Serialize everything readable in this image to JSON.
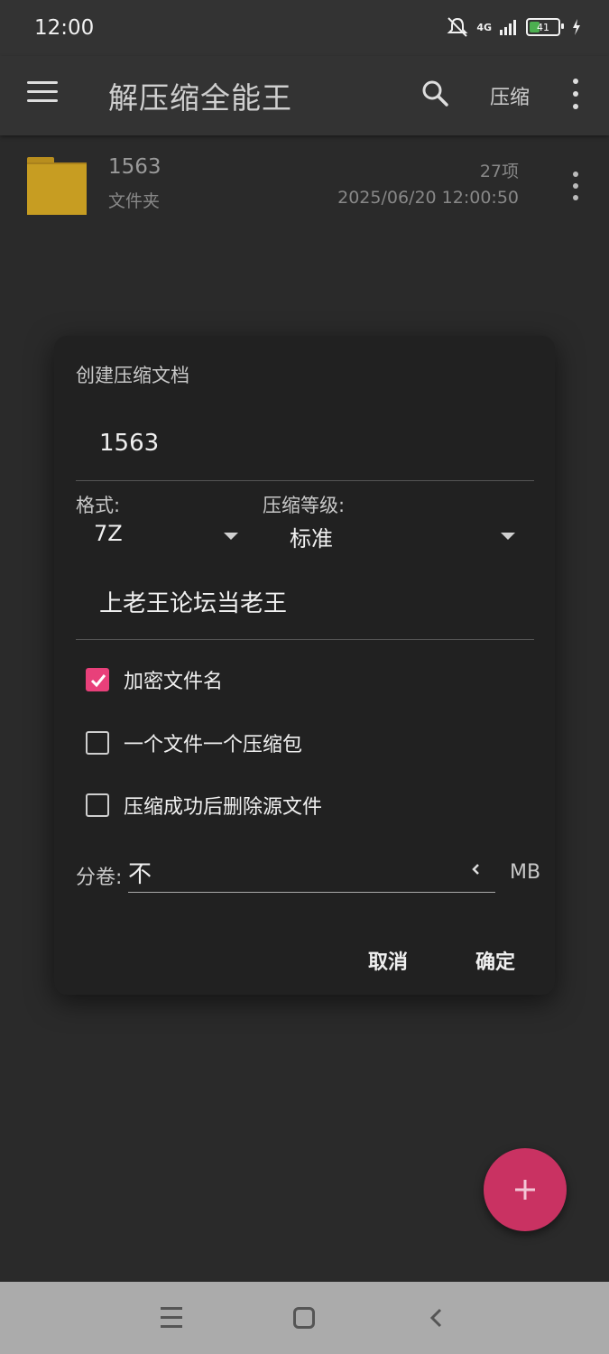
{
  "status_bar": {
    "time": "12:00",
    "network": "4G",
    "battery": "41",
    "battery_level": 0.41
  },
  "app_bar": {
    "title": "解压缩全能王",
    "compress_action": "压缩"
  },
  "file_list": [
    {
      "name": "1563",
      "type": "文件夹",
      "count": "27项",
      "date": "2025/06/20 12:00:50"
    }
  ],
  "dialog": {
    "title": "创建压缩文档",
    "archive_name": "1563",
    "format_label": "格式:",
    "format_value": "7Z",
    "level_label": "压缩等级:",
    "level_value": "标准",
    "password": "上老王论坛当老王",
    "options": [
      {
        "label": "加密文件名",
        "checked": true
      },
      {
        "label": "一个文件一个压缩包",
        "checked": false
      },
      {
        "label": "压缩成功后删除源文件",
        "checked": false
      }
    ],
    "split_label": "分卷:",
    "split_value": "不",
    "split_unit": "MB",
    "cancel": "取消",
    "confirm": "确定"
  },
  "colors": {
    "accent": "#e8407a",
    "fab": "#c93262",
    "folder": "#c79d22"
  }
}
